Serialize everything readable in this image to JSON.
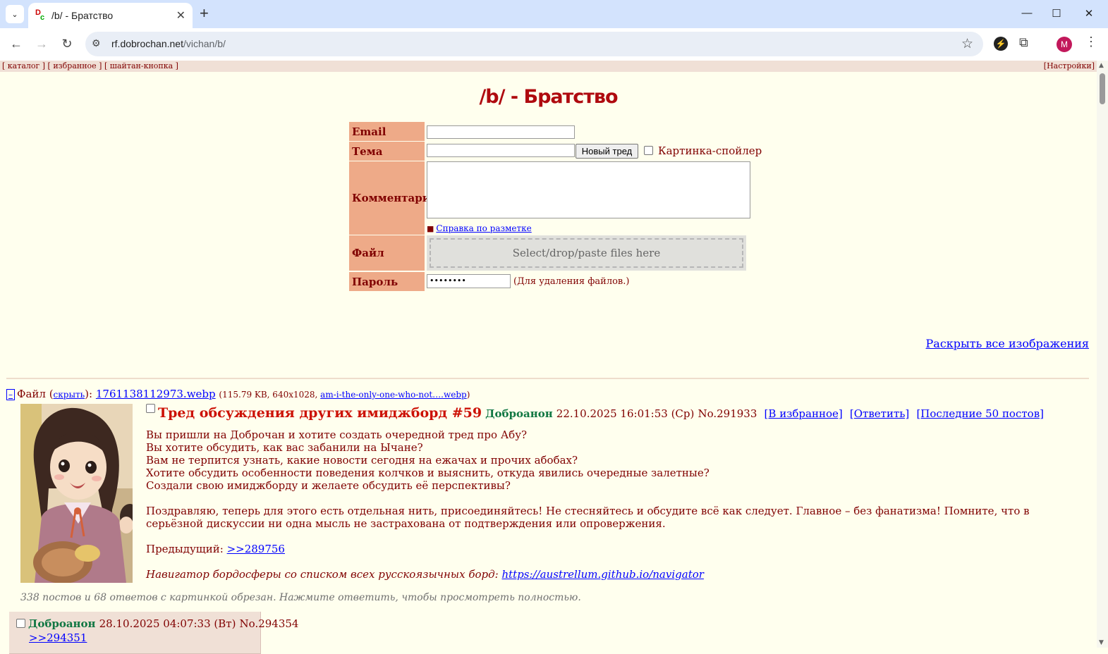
{
  "browser": {
    "tab_title": "/b/ - Братство",
    "favicon_d": "D",
    "favicon_c": "c",
    "url_host": "rf.dobrochan.net",
    "url_path": "/vichan/b/",
    "profile_initial": "M"
  },
  "topbar": {
    "links": [
      "каталог",
      "избранное",
      "шайтан-кнопка"
    ],
    "settings": "Настройки"
  },
  "board": {
    "title": "/b/ - Братство"
  },
  "form": {
    "email_label": "Email",
    "subject_label": "Тема",
    "comment_label": "Комментарий",
    "file_label": "Файл",
    "password_label": "Пароль",
    "new_thread_button": "Новый тред",
    "spoiler_label": "Картинка-спойлер",
    "markup_help": "Справка по разметке",
    "dropzone_text": "Select/drop/paste files here",
    "password_value": "••••••••",
    "password_hint": "(Для удаления файлов.)"
  },
  "expand_all": "Раскрыть все изображения",
  "op": {
    "file_prefix": "Файл",
    "hide_link": "скрыть",
    "filename": "1761138112973.webp",
    "file_size": "115.79 KB, 640x1028,",
    "original_name": "am-i-the-only-one-who-not….webp",
    "subject": "Тред обсуждения других имиджборд #59",
    "name": "Доброанон",
    "datetime": "22.10.2025 16:01:53 (Ср)",
    "number": "No.291933",
    "favorite_link": "[В избранное]",
    "reply_link": "[Ответить]",
    "last50_link": "[Последние 50 постов]",
    "lines": [
      "Вы пришли на Доброчан и хотите создать очередной тред про Абу?",
      "Вы хотите обсудить, как вас забанили на Ычане?",
      "Вам не терпится узнать, какие новости сегодня на ежачах и прочих абобах?",
      "Хотите обсудить особенности поведения колчков и выяснить, откуда явились очередные залетные?",
      "Создали свою имиджборду и желаете обсудить её перспективы?"
    ],
    "paragraph": "Поздравляю, теперь для этого есть отдельная нить, присоединяйтесь! Не стесняйтесь и обсудите всё как следует. Главное – без фанатизма! Помните, что в серьёзной дискуссии ни одна мысль не застрахована от подтверждения или опровержения.",
    "prev_label": "Предыдущий:",
    "prev_link": ">>289756",
    "navigator_text": "Навигатор бордосферы со списком всех русскоязычных борд:",
    "navigator_link": "https://austrellum.github.io/navigator"
  },
  "omitted": "338 постов и 68 ответов с картинкой обрезан. Нажмите ответить, чтобы просмотреть полностью.",
  "reply": {
    "name": "Доброанон",
    "datetime": "28.10.2025 04:07:33 (Вт)",
    "number": "No.294354",
    "quote": ">>294351"
  }
}
